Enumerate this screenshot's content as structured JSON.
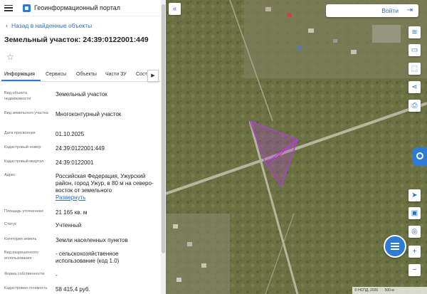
{
  "header": {
    "app_title": "Геоинформационный портал"
  },
  "nav": {
    "back_label": "Назад в найденные объекты"
  },
  "object": {
    "title": "Земельный участок: 24:39:0122001:449"
  },
  "tabs": [
    {
      "label": "Информация",
      "active": true
    },
    {
      "label": "Сервисы"
    },
    {
      "label": "Объекты"
    },
    {
      "label": "Части ЗУ"
    },
    {
      "label": "Сост"
    }
  ],
  "attributes": [
    {
      "label": "Вид объекта недвижимости",
      "value": "Земельный участок"
    },
    {
      "label": "Вид земельного участка",
      "value": "Многоконтурный участок"
    },
    {
      "label": "Дата присвоения",
      "value": "01.10.2025"
    },
    {
      "label": "Кадастровый номер",
      "value": "24:39:0122001:449"
    },
    {
      "label": "Кадастровый квартал",
      "value": "24:39:0122001"
    },
    {
      "label": "Адрес",
      "value": "Российская Федерация, Ужурский район, город Ужур, в 80 м на северо-восток от земельного",
      "link": "Развернуть"
    },
    {
      "label": "Площадь уточненная",
      "value": "21 165 кв. м"
    },
    {
      "label": "Статус",
      "value": "Учтенный"
    },
    {
      "label": "Категория земель",
      "value": "Земли населенных пунктов"
    },
    {
      "label": "Вид разрешенного использования",
      "value": "- сельскохозяйственное использование (код 1.0)"
    },
    {
      "label": "Форма собственности",
      "value": "-"
    },
    {
      "label": "Кадастровая стоимость",
      "value": "58 415,4 руб."
    }
  ],
  "map": {
    "login_label": "Войти",
    "copyright": "© НСПД, 2026",
    "scale": "500 м"
  },
  "colors": {
    "accent": "#2e7bd6",
    "parcel": "#b040d0"
  }
}
